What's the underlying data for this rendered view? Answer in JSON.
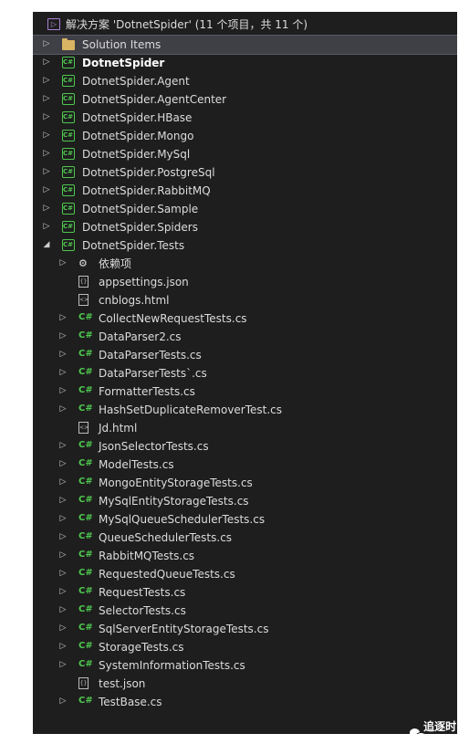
{
  "solution": {
    "title": "解决方案 'DotnetSpider' (11 个项目，共 11 个)",
    "icon": "solution-icon"
  },
  "tree": [
    {
      "label": "Solution Items",
      "icon": "folder-icon",
      "indent": 0,
      "arrow": "collapsed",
      "selected": true
    },
    {
      "label": "DotnetSpider",
      "icon": "csharp-project-icon",
      "indent": 0,
      "arrow": "collapsed",
      "bold": true
    },
    {
      "label": "DotnetSpider.Agent",
      "icon": "csharp-project-icon",
      "indent": 0,
      "arrow": "collapsed"
    },
    {
      "label": "DotnetSpider.AgentCenter",
      "icon": "csharp-project-icon",
      "indent": 0,
      "arrow": "collapsed"
    },
    {
      "label": "DotnetSpider.HBase",
      "icon": "csharp-project-icon",
      "indent": 0,
      "arrow": "collapsed"
    },
    {
      "label": "DotnetSpider.Mongo",
      "icon": "csharp-project-icon",
      "indent": 0,
      "arrow": "collapsed"
    },
    {
      "label": "DotnetSpider.MySql",
      "icon": "csharp-project-icon",
      "indent": 0,
      "arrow": "collapsed"
    },
    {
      "label": "DotnetSpider.PostgreSql",
      "icon": "csharp-project-icon",
      "indent": 0,
      "arrow": "collapsed"
    },
    {
      "label": "DotnetSpider.RabbitMQ",
      "icon": "csharp-project-icon",
      "indent": 0,
      "arrow": "collapsed"
    },
    {
      "label": "DotnetSpider.Sample",
      "icon": "csharp-project-icon",
      "indent": 0,
      "arrow": "collapsed"
    },
    {
      "label": "DotnetSpider.Spiders",
      "icon": "csharp-project-icon",
      "indent": 0,
      "arrow": "collapsed"
    },
    {
      "label": "DotnetSpider.Tests",
      "icon": "csharp-project-icon",
      "indent": 0,
      "arrow": "expanded"
    },
    {
      "label": "依赖项",
      "icon": "dependencies-icon",
      "indent": 1,
      "arrow": "collapsed"
    },
    {
      "label": "appsettings.json",
      "icon": "json-file-icon",
      "indent": 1,
      "arrow": "none"
    },
    {
      "label": "cnblogs.html",
      "icon": "html-file-icon",
      "indent": 1,
      "arrow": "none"
    },
    {
      "label": "CollectNewRequestTests.cs",
      "icon": "csharp-file-icon",
      "indent": 1,
      "arrow": "collapsed"
    },
    {
      "label": "DataParser2.cs",
      "icon": "csharp-file-icon",
      "indent": 1,
      "arrow": "collapsed"
    },
    {
      "label": "DataParserTests.cs",
      "icon": "csharp-file-icon",
      "indent": 1,
      "arrow": "collapsed"
    },
    {
      "label": "DataParserTests`.cs",
      "icon": "csharp-file-icon",
      "indent": 1,
      "arrow": "collapsed"
    },
    {
      "label": "FormatterTests.cs",
      "icon": "csharp-file-icon",
      "indent": 1,
      "arrow": "collapsed"
    },
    {
      "label": "HashSetDuplicateRemoverTest.cs",
      "icon": "csharp-file-icon",
      "indent": 1,
      "arrow": "collapsed"
    },
    {
      "label": "Jd.html",
      "icon": "html-file-icon",
      "indent": 1,
      "arrow": "none"
    },
    {
      "label": "JsonSelectorTests.cs",
      "icon": "csharp-file-icon",
      "indent": 1,
      "arrow": "collapsed"
    },
    {
      "label": "ModelTests.cs",
      "icon": "csharp-file-icon",
      "indent": 1,
      "arrow": "collapsed"
    },
    {
      "label": "MongoEntityStorageTests.cs",
      "icon": "csharp-file-icon",
      "indent": 1,
      "arrow": "collapsed"
    },
    {
      "label": "MySqlEntityStorageTests.cs",
      "icon": "csharp-file-icon",
      "indent": 1,
      "arrow": "collapsed"
    },
    {
      "label": "MySqlQueueSchedulerTests.cs",
      "icon": "csharp-file-icon",
      "indent": 1,
      "arrow": "collapsed"
    },
    {
      "label": "QueueSchedulerTests.cs",
      "icon": "csharp-file-icon",
      "indent": 1,
      "arrow": "collapsed"
    },
    {
      "label": "RabbitMQTests.cs",
      "icon": "csharp-file-icon",
      "indent": 1,
      "arrow": "collapsed"
    },
    {
      "label": "RequestedQueueTests.cs",
      "icon": "csharp-file-icon",
      "indent": 1,
      "arrow": "collapsed"
    },
    {
      "label": "RequestTests.cs",
      "icon": "csharp-file-icon",
      "indent": 1,
      "arrow": "collapsed"
    },
    {
      "label": "SelectorTests.cs",
      "icon": "csharp-file-icon",
      "indent": 1,
      "arrow": "collapsed"
    },
    {
      "label": "SqlServerEntityStorageTests.cs",
      "icon": "csharp-file-icon",
      "indent": 1,
      "arrow": "collapsed"
    },
    {
      "label": "StorageTests.cs",
      "icon": "csharp-file-icon",
      "indent": 1,
      "arrow": "collapsed"
    },
    {
      "label": "SystemInformationTests.cs",
      "icon": "csharp-file-icon",
      "indent": 1,
      "arrow": "collapsed"
    },
    {
      "label": "test.json",
      "icon": "json-file-icon",
      "indent": 1,
      "arrow": "none"
    },
    {
      "label": "TestBase.cs",
      "icon": "csharp-file-icon",
      "indent": 1,
      "arrow": "collapsed"
    }
  ],
  "watermark": {
    "text": "追逐时光者",
    "icon": "wechat-icon"
  },
  "colors": {
    "background": "#1e1e1e",
    "selected": "#3f3f46",
    "csharp": "#4ec74e",
    "text": "#dcdcdc"
  }
}
